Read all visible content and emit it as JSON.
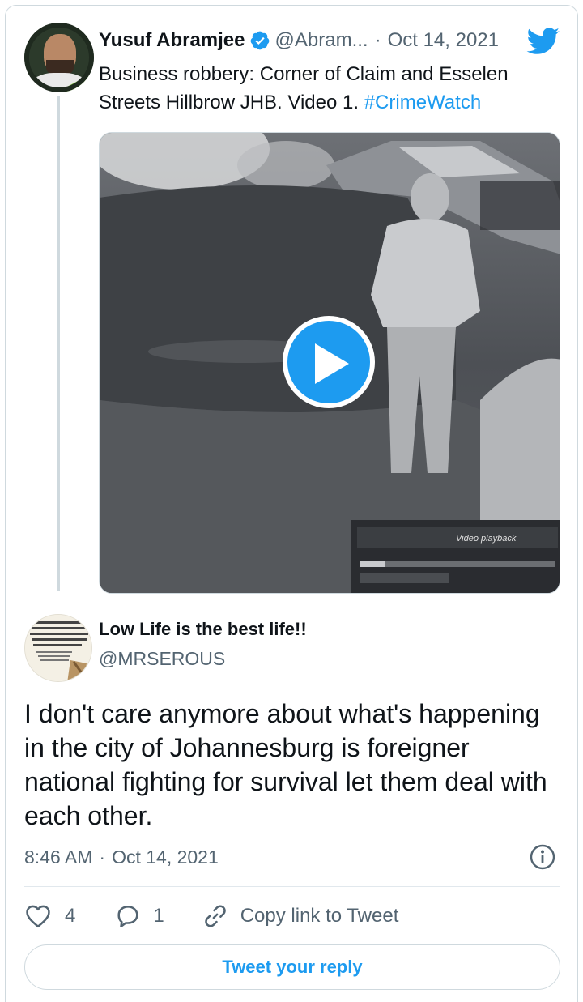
{
  "colors": {
    "accent": "#1d9bf0",
    "text_primary": "#0f1419",
    "text_secondary": "#536471",
    "border": "#cfd9de"
  },
  "parent_tweet": {
    "author_name": "Yusuf Abramjee",
    "verified_icon": "verified-badge-icon",
    "handle": "@Abram...",
    "separator": "·",
    "date": "Oct 14, 2021",
    "brand_icon": "twitter-bird-icon",
    "text_main": "Business robbery: Corner of Claim and Esselen Streets Hillbrow JHB. Video 1. ",
    "hashtag": "#CrimeWatch",
    "media": {
      "type": "video",
      "play_icon": "play-icon",
      "overlay_text": "Video playback"
    }
  },
  "reply_tweet": {
    "author_name": "Low Life is the best life!!",
    "handle": "@MRSEROUS",
    "avatar_text": "...nly in Africa w... ...ieves be regrouping to loot again and the youths whose future is being stolen will be celebrating it...",
    "text": "I don't care anymore about what's happening in the city of Johannesburg is foreigner national fighting for survival let them deal with each other.",
    "time": "8:46 AM",
    "separator": "·",
    "date": "Oct 14, 2021",
    "info_icon": "info-icon"
  },
  "actions": {
    "like_count": "4",
    "reply_count": "1",
    "copy_label": "Copy link to Tweet",
    "like_icon": "heart-icon",
    "reply_icon": "comment-icon",
    "copy_icon": "link-icon"
  },
  "reply_button": {
    "label": "Tweet your reply"
  }
}
